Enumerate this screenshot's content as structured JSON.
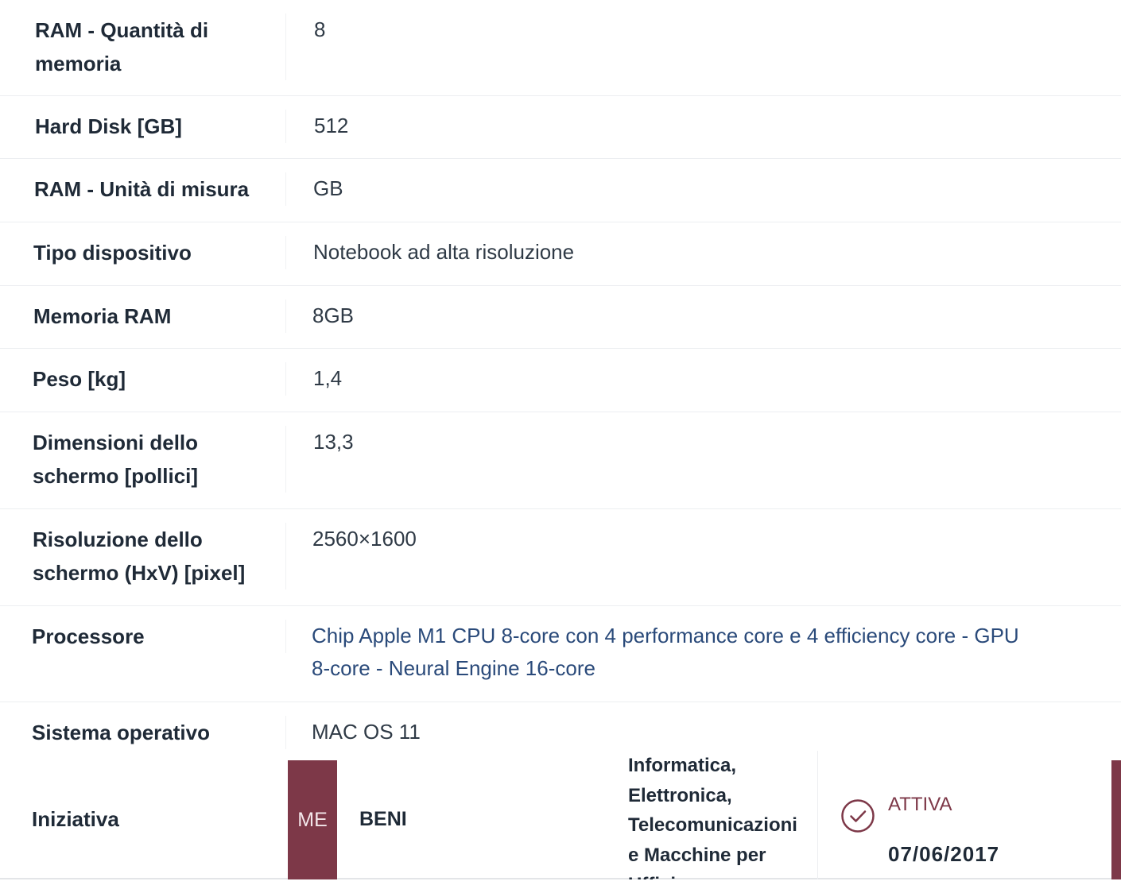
{
  "specs": [
    {
      "label_lines": [
        "RAM - Quantità di",
        "memoria"
      ],
      "value_lines": [
        "8"
      ]
    },
    {
      "label_lines": [
        "Hard Disk [GB]"
      ],
      "value_lines": [
        "512"
      ]
    },
    {
      "label_lines": [
        "RAM - Unità di misura"
      ],
      "value_lines": [
        "GB"
      ]
    },
    {
      "label_lines": [
        "Tipo dispositivo"
      ],
      "value_lines": [
        "Notebook ad alta risoluzione"
      ]
    },
    {
      "label_lines": [
        "Memoria RAM"
      ],
      "value_lines": [
        "8GB"
      ]
    },
    {
      "label_lines": [
        "Peso [kg]"
      ],
      "value_lines": [
        "1,4"
      ]
    },
    {
      "label_lines": [
        "Dimensioni dello",
        "schermo [pollici]"
      ],
      "value_lines": [
        "13,3"
      ]
    },
    {
      "label_lines": [
        "Risoluzione dello",
        "schermo (HxV) [pixel]"
      ],
      "value_lines": [
        "2560×1600"
      ]
    },
    {
      "label_lines": [
        "Processore"
      ],
      "value_lines": [
        "Chip Apple M1 CPU 8-core con 4 performance core e 4 efficiency core - GPU",
        "8-core - Neural Engine 16-core"
      ]
    },
    {
      "label_lines": [
        "Sistema operativo"
      ],
      "value_lines": [
        "MAC OS 11"
      ]
    }
  ],
  "initiative": {
    "label": "Iniziativa",
    "badge": "ME",
    "type": "BENI",
    "category_lines": [
      "Informatica,",
      "Elettronica,",
      "Telecomunicazioni",
      "e Macchine per",
      "Ufficio"
    ],
    "status": "ATTIVA",
    "date": "07/06/2017",
    "status_icon": "check-circle-icon",
    "accent_color": "#7d3848"
  }
}
